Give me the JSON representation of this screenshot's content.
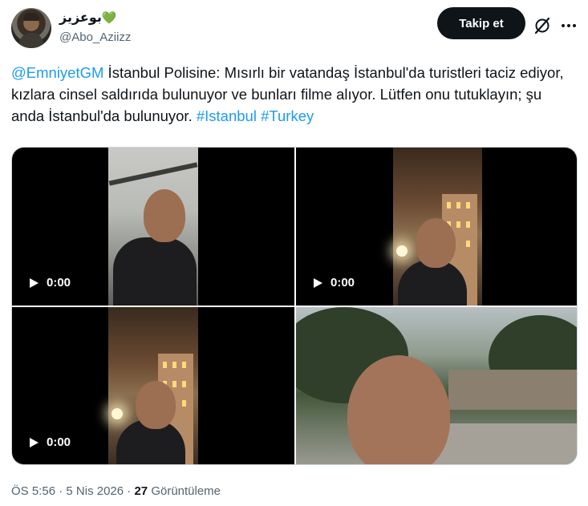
{
  "author": {
    "display_name": "بوعزيز",
    "name_emoji": "💚",
    "handle": "@Abo_Aziizz",
    "avatar_icon": "avatar-image"
  },
  "actions": {
    "follow_label": "Takip et",
    "grok_icon": "grok-icon",
    "more_icon": "more-icon"
  },
  "tweet": {
    "mention": "@EmniyetGM",
    "body": " İstanbul Polisine: Mısırlı bir vatandaş İstanbul'da turistleri taciz ediyor, kızlara cinsel saldırıda bulunuyor ve bunları filme alıyor. Lütfen onu tutuklayın; şu anda İstanbul'da bulunuyor. ",
    "hashtags": [
      "#Istanbul",
      "#Turkey"
    ]
  },
  "media": [
    {
      "type": "video",
      "duration": "0:00"
    },
    {
      "type": "video",
      "duration": "0:00"
    },
    {
      "type": "video",
      "duration": "0:00"
    },
    {
      "type": "image"
    }
  ],
  "meta": {
    "time": "ÖS 5:56",
    "separator": "·",
    "date": "5 Nis 2026",
    "views_count": "27",
    "views_label": "Görüntüleme"
  }
}
